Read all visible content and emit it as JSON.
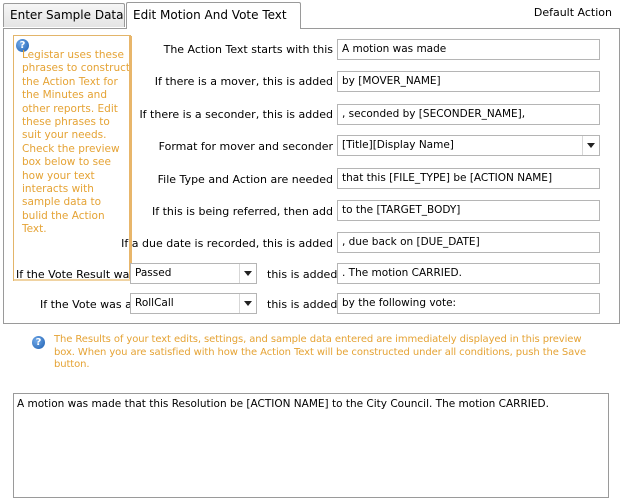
{
  "tabs": [
    {
      "label": "Enter Sample Data"
    },
    {
      "label": "Edit Motion And Vote Text"
    }
  ],
  "header": {
    "default_action": "Default Action"
  },
  "help": {
    "text": "Legistar uses these phrases to construct the Action Text for the Minutes and other reports. Edit these phrases to suit your needs. Check the preview box below to see how your text interacts with sample data to bulid the Action Text."
  },
  "rows": [
    {
      "label": "The Action Text starts with this",
      "value": "A motion was made"
    },
    {
      "label": "If there is a mover, this is added",
      "value": "by [MOVER_NAME]"
    },
    {
      "label": "If there is a seconder, this is added",
      "value": ", seconded by [SECONDER_NAME],"
    },
    {
      "label": "Format for mover and seconder",
      "value": "[Title][Display Name]"
    },
    {
      "label": "File Type and Action are needed",
      "value": "that this  [FILE_TYPE] be [ACTION NAME]"
    },
    {
      "label": "If this is being referred, then add",
      "value": "to the [TARGET_BODY]"
    },
    {
      "label": "If a due date is recorded, this is added",
      "value": ", due back on [DUE_DATE]"
    }
  ],
  "vote_result": {
    "label": "If the Vote Result was",
    "selected": "Passed",
    "added_label": "this is added",
    "value": ".  The motion CARRIED."
  },
  "vote_type": {
    "label": "If the Vote was a",
    "selected": "RollCall",
    "added_label": "this is added",
    "value": " by the following vote:"
  },
  "info": {
    "text": "The Results of your text edits, settings, and sample data entered are immediately displayed in this preview box. When you are satisfied with how the Action Text will be constructed under all conditions, push the Save button."
  },
  "preview": {
    "text": "A motion was made that this  Resolution be [ACTION NAME] to the City Council.  The motion CARRIED."
  }
}
